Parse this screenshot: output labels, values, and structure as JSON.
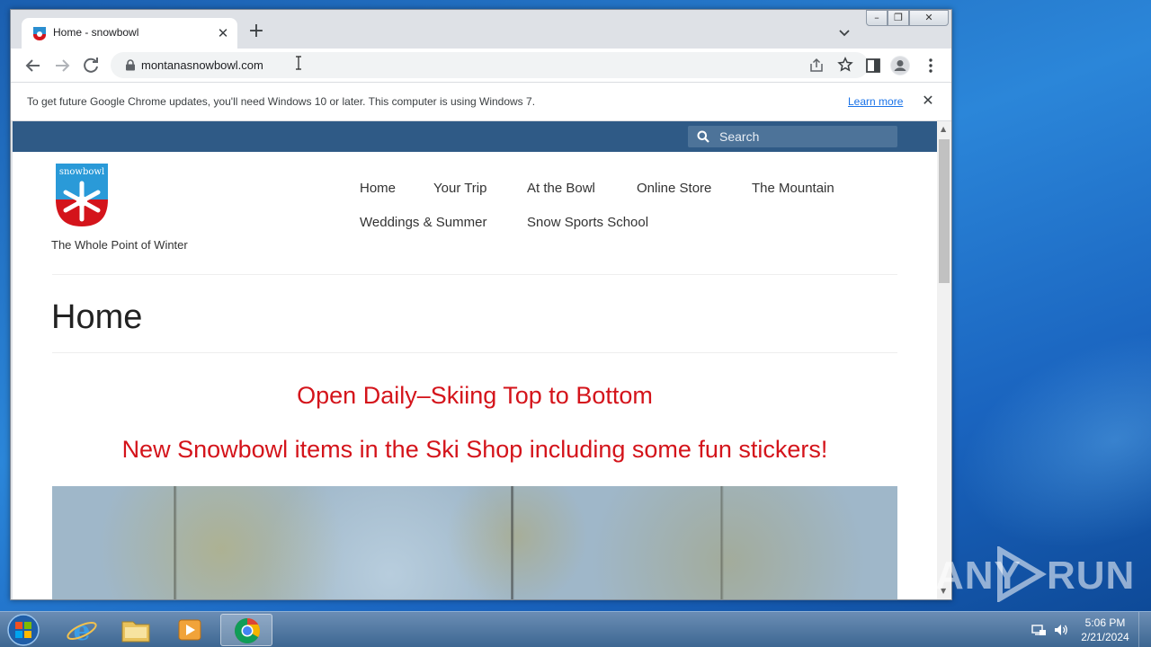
{
  "browser": {
    "tab_title": "Home - snowbowl",
    "url": "montanasnowbowl.com",
    "infobar_message": "To get future Google Chrome updates, you'll need Windows 10 or later. This computer is using Windows 7.",
    "infobar_link": "Learn more"
  },
  "site": {
    "search_placeholder": "Search",
    "logo_text": "snowbowl",
    "tagline": "The Whole Point of Winter",
    "nav": [
      "Home",
      "Your Trip",
      "At the Bowl",
      "Online Store",
      "The Mountain",
      "Weddings & Summer",
      "Snow Sports School"
    ],
    "page_title": "Home",
    "notices": [
      "Open Daily–Skiing Top to Bottom",
      "New Snowbowl items in the Ski Shop including some fun stickers!"
    ],
    "notice_color": "#d4141b",
    "header_color": "#2f5a86"
  },
  "taskbar": {
    "time": "5:06 PM",
    "date": "2/21/2024"
  },
  "watermark": {
    "left": "ANY",
    "right": "RUN"
  }
}
